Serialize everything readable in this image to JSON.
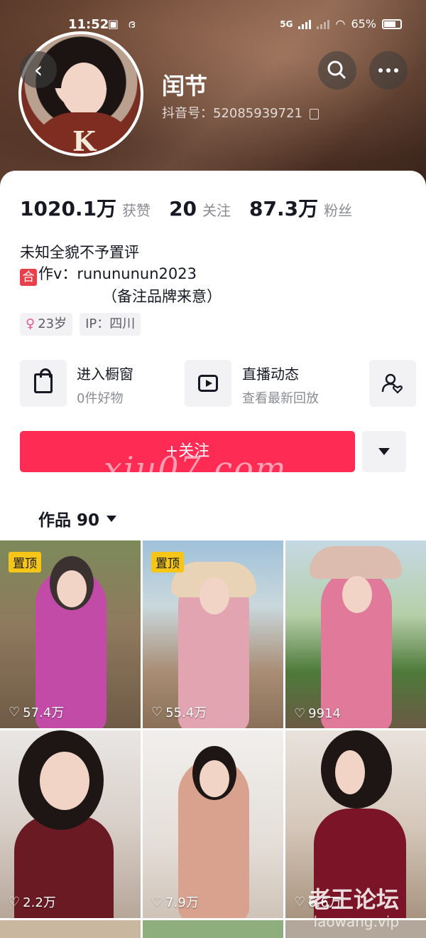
{
  "status_bar": {
    "time": "11:52",
    "app_icons": "▣ ദ",
    "network": "5G",
    "battery": "65%"
  },
  "profile": {
    "nickname": "闰节",
    "account_id": "抖音号：52085939721",
    "stats": [
      {
        "value": "1020.1万",
        "label": "获赞"
      },
      {
        "value": "20",
        "label": "关注"
      },
      {
        "value": "87.3万",
        "label": "粉丝"
      }
    ],
    "bio_line1": "未知全貌不予置评",
    "bio_badge": "合",
    "bio_line2": "作v：runununun2023",
    "bio_line3": "（备注品牌来意）",
    "tags": {
      "age": "23岁",
      "ip": "IP：四川"
    }
  },
  "shortcuts": {
    "shop": {
      "title": "进入橱窗",
      "subtitle": "0件好物"
    },
    "live": {
      "title": "直播动态",
      "subtitle": "查看最新回放"
    }
  },
  "actions": {
    "follow_label": "+关注"
  },
  "works_tab": {
    "label": "作品 90"
  },
  "pin_label": "置顶",
  "videos": [
    {
      "likes": "57.4万",
      "pinned": true,
      "color": "#c24ba8"
    },
    {
      "likes": "55.4万",
      "pinned": true,
      "color": "#e3a4b2"
    },
    {
      "likes": "9914",
      "pinned": false,
      "color": "#e0799a"
    },
    {
      "likes": "2.2万",
      "pinned": false,
      "color": "#6a1a22"
    },
    {
      "likes": "7.9万",
      "pinned": false,
      "color": "#d9a28f"
    },
    {
      "likes": "6.6万",
      "pinned": false,
      "color": "#7a1426"
    }
  ],
  "watermarks": {
    "center": "xiu07.com",
    "title": "老王论坛",
    "url": "laowang.vip"
  },
  "colors": {
    "accent": "#fe2c55",
    "pin": "#f5c518"
  }
}
